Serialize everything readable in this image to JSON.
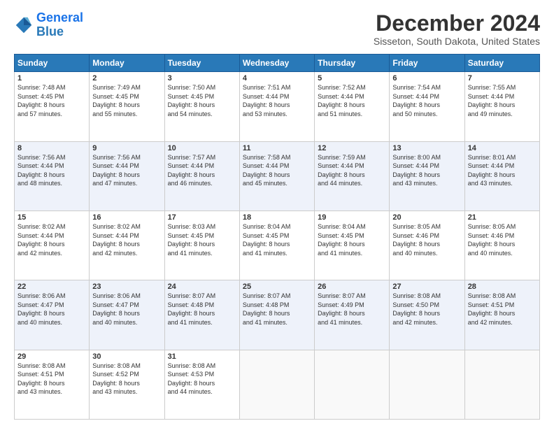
{
  "logo": {
    "line1": "General",
    "line2": "Blue"
  },
  "title": "December 2024",
  "subtitle": "Sisseton, South Dakota, United States",
  "days_of_week": [
    "Sunday",
    "Monday",
    "Tuesday",
    "Wednesday",
    "Thursday",
    "Friday",
    "Saturday"
  ],
  "weeks": [
    [
      {
        "day": "1",
        "sunrise": "7:48 AM",
        "sunset": "4:45 PM",
        "daylight": "8 hours and 57 minutes."
      },
      {
        "day": "2",
        "sunrise": "7:49 AM",
        "sunset": "4:45 PM",
        "daylight": "8 hours and 55 minutes."
      },
      {
        "day": "3",
        "sunrise": "7:50 AM",
        "sunset": "4:45 PM",
        "daylight": "8 hours and 54 minutes."
      },
      {
        "day": "4",
        "sunrise": "7:51 AM",
        "sunset": "4:44 PM",
        "daylight": "8 hours and 53 minutes."
      },
      {
        "day": "5",
        "sunrise": "7:52 AM",
        "sunset": "4:44 PM",
        "daylight": "8 hours and 51 minutes."
      },
      {
        "day": "6",
        "sunrise": "7:54 AM",
        "sunset": "4:44 PM",
        "daylight": "8 hours and 50 minutes."
      },
      {
        "day": "7",
        "sunrise": "7:55 AM",
        "sunset": "4:44 PM",
        "daylight": "8 hours and 49 minutes."
      }
    ],
    [
      {
        "day": "8",
        "sunrise": "7:56 AM",
        "sunset": "4:44 PM",
        "daylight": "8 hours and 48 minutes."
      },
      {
        "day": "9",
        "sunrise": "7:56 AM",
        "sunset": "4:44 PM",
        "daylight": "8 hours and 47 minutes."
      },
      {
        "day": "10",
        "sunrise": "7:57 AM",
        "sunset": "4:44 PM",
        "daylight": "8 hours and 46 minutes."
      },
      {
        "day": "11",
        "sunrise": "7:58 AM",
        "sunset": "4:44 PM",
        "daylight": "8 hours and 45 minutes."
      },
      {
        "day": "12",
        "sunrise": "7:59 AM",
        "sunset": "4:44 PM",
        "daylight": "8 hours and 44 minutes."
      },
      {
        "day": "13",
        "sunrise": "8:00 AM",
        "sunset": "4:44 PM",
        "daylight": "8 hours and 43 minutes."
      },
      {
        "day": "14",
        "sunrise": "8:01 AM",
        "sunset": "4:44 PM",
        "daylight": "8 hours and 43 minutes."
      }
    ],
    [
      {
        "day": "15",
        "sunrise": "8:02 AM",
        "sunset": "4:44 PM",
        "daylight": "8 hours and 42 minutes."
      },
      {
        "day": "16",
        "sunrise": "8:02 AM",
        "sunset": "4:44 PM",
        "daylight": "8 hours and 42 minutes."
      },
      {
        "day": "17",
        "sunrise": "8:03 AM",
        "sunset": "4:45 PM",
        "daylight": "8 hours and 41 minutes."
      },
      {
        "day": "18",
        "sunrise": "8:04 AM",
        "sunset": "4:45 PM",
        "daylight": "8 hours and 41 minutes."
      },
      {
        "day": "19",
        "sunrise": "8:04 AM",
        "sunset": "4:45 PM",
        "daylight": "8 hours and 41 minutes."
      },
      {
        "day": "20",
        "sunrise": "8:05 AM",
        "sunset": "4:46 PM",
        "daylight": "8 hours and 40 minutes."
      },
      {
        "day": "21",
        "sunrise": "8:05 AM",
        "sunset": "4:46 PM",
        "daylight": "8 hours and 40 minutes."
      }
    ],
    [
      {
        "day": "22",
        "sunrise": "8:06 AM",
        "sunset": "4:47 PM",
        "daylight": "8 hours and 40 minutes."
      },
      {
        "day": "23",
        "sunrise": "8:06 AM",
        "sunset": "4:47 PM",
        "daylight": "8 hours and 40 minutes."
      },
      {
        "day": "24",
        "sunrise": "8:07 AM",
        "sunset": "4:48 PM",
        "daylight": "8 hours and 41 minutes."
      },
      {
        "day": "25",
        "sunrise": "8:07 AM",
        "sunset": "4:48 PM",
        "daylight": "8 hours and 41 minutes."
      },
      {
        "day": "26",
        "sunrise": "8:07 AM",
        "sunset": "4:49 PM",
        "daylight": "8 hours and 41 minutes."
      },
      {
        "day": "27",
        "sunrise": "8:08 AM",
        "sunset": "4:50 PM",
        "daylight": "8 hours and 42 minutes."
      },
      {
        "day": "28",
        "sunrise": "8:08 AM",
        "sunset": "4:51 PM",
        "daylight": "8 hours and 42 minutes."
      }
    ],
    [
      {
        "day": "29",
        "sunrise": "8:08 AM",
        "sunset": "4:51 PM",
        "daylight": "8 hours and 43 minutes."
      },
      {
        "day": "30",
        "sunrise": "8:08 AM",
        "sunset": "4:52 PM",
        "daylight": "8 hours and 43 minutes."
      },
      {
        "day": "31",
        "sunrise": "8:08 AM",
        "sunset": "4:53 PM",
        "daylight": "8 hours and 44 minutes."
      },
      null,
      null,
      null,
      null
    ]
  ]
}
